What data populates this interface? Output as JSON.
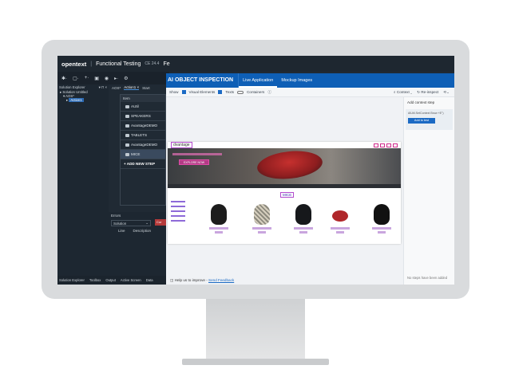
{
  "ide": {
    "brand": "opentext",
    "app": "Functional Testing",
    "version": "CE 24.4",
    "extra": "Fe",
    "toolbar": [
      "✱·",
      "▢·",
      "+·",
      "▣",
      "◉",
      "▸·",
      "⚙"
    ],
    "solution": {
      "title": "Solution Explorer",
      "nodes": [
        "Solution Untitled",
        "AOS*",
        "Action1"
      ]
    },
    "doc_tabs": [
      "AOS*",
      "Action1 ×",
      "Start"
    ],
    "steps_header": "Item",
    "steps": [
      "AUtil",
      "SPEAKERS",
      "AvantageDEMO",
      "TABLETS",
      "AvantageDEMO",
      "MICE"
    ],
    "add_step": "+ ADD NEW STEP",
    "errors": {
      "title": "Errors",
      "filter": "Solution",
      "cols": [
        "Line",
        "Description"
      ],
      "current": "Cur"
    },
    "bottom_tabs": [
      "Solution Explorer",
      "Toolbox",
      "Output",
      "Active Screen",
      "Data"
    ]
  },
  "ai": {
    "title": "AI OBJECT INSPECTION",
    "tabs": [
      "Live Application",
      "Mockup Images"
    ],
    "show_label": "Show",
    "visual_elements": "Visual Elements",
    "texts": "Texts",
    "containers": "Containers",
    "context": "Context",
    "reinspect": "Re-inspect",
    "feedback_prefix": "Help us to improve -",
    "feedback_link": "Send Feedback",
    "site": {
      "logo": "dvantage",
      "banner_btn": "EXPLORE NOW",
      "section": "MICE"
    },
    "steps_pane": {
      "title": "Add context step",
      "card_text": "AIUtil.SetContext Brow +E\")",
      "add_button": "Add to test",
      "empty": "No steps have been added"
    }
  }
}
